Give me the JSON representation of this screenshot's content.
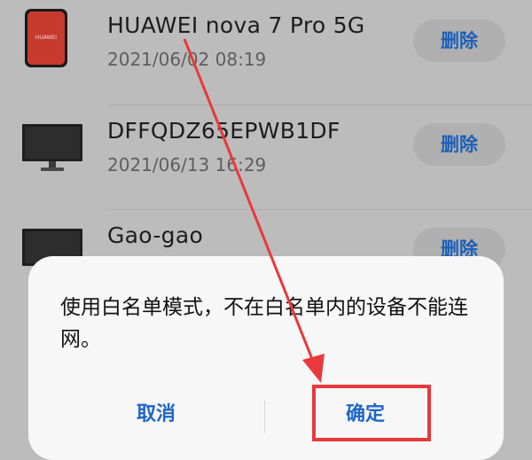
{
  "devices": [
    {
      "name": "HUAWEI nova 7 Pro 5G",
      "date": "2021/06/02 08:19",
      "icon": "phone-icon",
      "brand_text": "HUAWEI",
      "delete_label": "删除"
    },
    {
      "name": "DFFQDZ65EPWB1DF",
      "date": "2021/06/13 16:29",
      "icon": "monitor-icon",
      "delete_label": "删除"
    },
    {
      "name": "Gao-gao",
      "date": "",
      "icon": "monitor-icon",
      "delete_label": "删除"
    }
  ],
  "dialog": {
    "message": "使用白名单模式，不在白名单内的设备不能连网。",
    "cancel_label": "取消",
    "confirm_label": "确定"
  },
  "annotation": {
    "color": "#e8393c"
  }
}
